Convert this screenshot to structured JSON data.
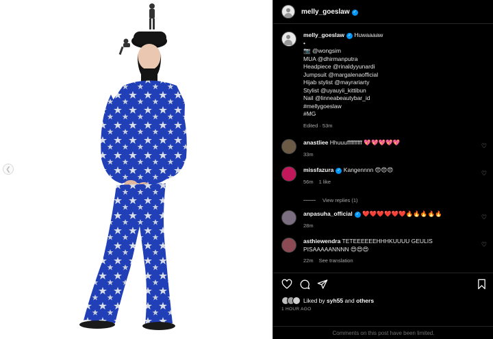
{
  "post": {
    "username": "melly_goeslaw",
    "nav_prev_icon": "chevron-left-icon"
  },
  "caption": {
    "username": "melly_goeslaw",
    "lines": [
      "Huwaaaaw",
      "•",
      "📷 @wongsim",
      "MUA @dhirmanputra",
      "Headpiece @rinaldyyunardi",
      "Jumpsuit @margalenaofficial",
      "Hijab stylist @mayrariarty",
      "Stylist @uyauyii_kittibun",
      "Nail @linneabeautybar_id",
      "#mellygoeslaw",
      "#MG"
    ],
    "meta": "Edited · 53m"
  },
  "comments": [
    {
      "user": "anastliee",
      "text": "Hhuuuffffffffff 💖💖💖💖💖",
      "time": "33m",
      "likes": "",
      "reply": "",
      "avatar_color": "#6b5a45"
    },
    {
      "user": "missfazura",
      "text": "Kangennnn 😍😍😍",
      "time": "56m",
      "likes": "1 like",
      "reply": "",
      "avatar_color": "#c2185b"
    },
    {
      "user": "anpasuha_official",
      "text": "❤️❤️❤️❤️❤️❤️🔥🔥🔥🔥🔥",
      "time": "28m",
      "likes": "",
      "reply": "",
      "avatar_color": "#7a6e80"
    },
    {
      "user": "asthiewendra",
      "text": "TETEEEEEEHHHKUUUU GEULIS PISAAAAANNNN 😍😍😍",
      "time": "22m",
      "likes": "",
      "reply": "See translation",
      "avatar_color": "#8c4a55"
    }
  ],
  "view_replies": "View replies (1)",
  "actions": {
    "liked_prefix": "Liked by",
    "liked_user": "syh55",
    "liked_mid": "and",
    "liked_others": "others",
    "time_ago": "1 HOUR AGO",
    "limited": "Comments on this post have been limited."
  },
  "colors": {
    "accent": "#0095f6",
    "background": "#000000",
    "muted": "#a8a8a8",
    "suit_blue": "#1f3fb0"
  }
}
